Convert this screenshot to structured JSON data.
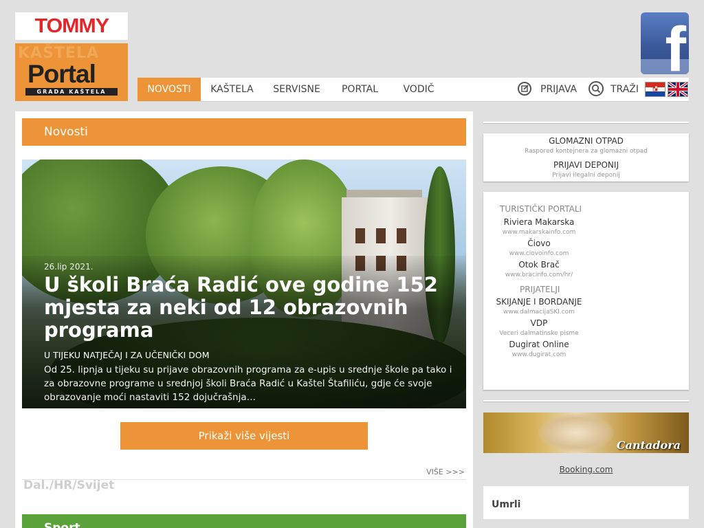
{
  "header": {
    "ad_brand": "TOMMY",
    "logo": {
      "bg_text": "KAŠTELA",
      "title": "Portal",
      "subtitle": "GRADA KAŠTELA"
    },
    "facebook_letter": "f"
  },
  "nav": {
    "items": [
      {
        "label": "NOVOSTI",
        "active": true
      },
      {
        "label": "KAŠTELA"
      },
      {
        "label": "SERVISNE"
      },
      {
        "label": "PORTAL"
      },
      {
        "label": "VODIČ"
      }
    ],
    "login_label": "PRIJAVA",
    "search_label": "TRAŽI"
  },
  "main": {
    "section_title": "Novosti",
    "featured": {
      "date": "26.lip 2021.",
      "headline": "U školi Braća Radić ove godine 152 mjesta za neki od 12 obrazovnih programa",
      "lead": "U TIJEKU NATJEČAJ I ZA UČENIČKI DOM",
      "excerpt": "Od 25. lipnja u tijeku su prijave obrazovnih programa za e-upis u srednje škole pa tako i za obrazovne programe u srednjoj školi Braća Radić u Kaštel Štafiliću, gdje će svoje obrazovanje moći nastaviti 152 dojučrašnja…"
    },
    "more_button": "Prikaži više vijesti",
    "more_link": "VIŠE >>>",
    "dal_section": "Dal./HR/Svijet",
    "sport_section": "Sport"
  },
  "sidebar": {
    "waste": {
      "items": [
        {
          "title": "GLOMAZNI OTPAD",
          "sub": "Raspored kontejnera za glomazni otpad"
        },
        {
          "title": "PRIJAVI DEPONIJ",
          "sub": "Prijavi ilegalni deponij"
        }
      ]
    },
    "portals": {
      "tourist_heading": "TURISTIČKI PORTALI",
      "tourist": [
        {
          "title": "Riviera Makarska",
          "sub": "www.makarskainfo.com"
        },
        {
          "title": "Čiovo",
          "sub": "www.ciovoinfo.com"
        },
        {
          "title": "Otok Brač",
          "sub": "www.bracinfo.com/hr/"
        }
      ],
      "friends_heading": "PRIJATELJI",
      "friends": [
        {
          "title": "SKIJANJE I BORDANJE",
          "sub": "www.dalmacijaSKI.com"
        },
        {
          "title": "VDP",
          "sub": "Veceri dalmatinske pisme"
        },
        {
          "title": "Dugirat Online",
          "sub": "www.dugirat.com"
        }
      ]
    },
    "banner_label": "Cantadora",
    "booking_link": "Booking.com",
    "umrli_title": "Umrli"
  },
  "colors": {
    "accent": "#ec9437",
    "sport": "#5aa33a",
    "facebook": "#3b5998"
  }
}
